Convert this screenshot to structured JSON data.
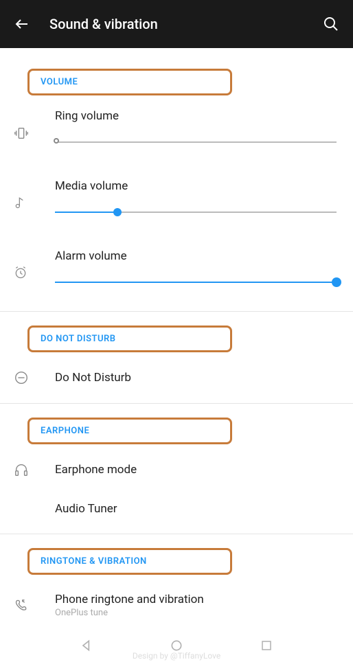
{
  "header": {
    "title": "Sound & vibration"
  },
  "sections": {
    "volume": {
      "header": "VOLUME",
      "ring": {
        "label": "Ring volume",
        "value": 0
      },
      "media": {
        "label": "Media volume",
        "value": 22
      },
      "alarm": {
        "label": "Alarm volume",
        "value": 100
      }
    },
    "dnd": {
      "header": "DO NOT DISTURB",
      "item": {
        "label": "Do Not Disturb"
      }
    },
    "earphone": {
      "header": "EARPHONE",
      "mode": {
        "label": "Earphone mode"
      },
      "tuner": {
        "label": "Audio Tuner"
      }
    },
    "ringtone": {
      "header": "RINGTONE & VIBRATION",
      "phone": {
        "label": "Phone ringtone and vibration",
        "sublabel": "OnePlus tune"
      }
    }
  },
  "watermark": "Design by @TiffanyLove"
}
